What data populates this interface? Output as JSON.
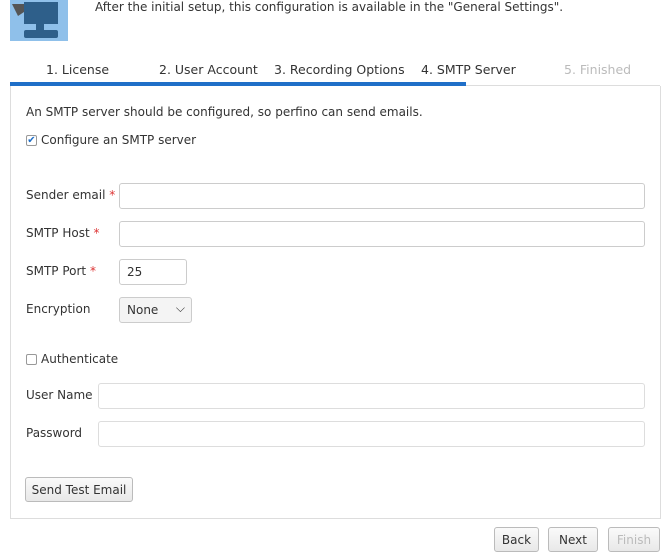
{
  "header": {
    "intro": "After the initial setup, this configuration is available in the \"General Settings\"."
  },
  "tabs": [
    {
      "label": "1. License"
    },
    {
      "label": "2. User Account"
    },
    {
      "label": "3. Recording Options"
    },
    {
      "label": "4. SMTP Server",
      "active": true
    },
    {
      "label": "5. Finished",
      "disabled": true
    }
  ],
  "progress_percent": 70,
  "form": {
    "description": "An SMTP server should be configured, so perfino can send emails.",
    "configure_smtp": {
      "label": "Configure an SMTP server",
      "checked": true
    },
    "sender_email": {
      "label": "Sender email",
      "required_mark": "*",
      "value": ""
    },
    "smtp_host": {
      "label": "SMTP Host",
      "required_mark": "*",
      "value": ""
    },
    "smtp_port": {
      "label": "SMTP Port",
      "required_mark": "*",
      "value": "25"
    },
    "encryption": {
      "label": "Encryption",
      "value": "None"
    },
    "authenticate": {
      "label": "Authenticate",
      "checked": false
    },
    "user_name": {
      "label": "User Name",
      "value": ""
    },
    "password": {
      "label": "Password",
      "value": ""
    },
    "send_test": "Send Test Email"
  },
  "footer": {
    "back": "Back",
    "next": "Next",
    "finish": "Finish"
  },
  "colors": {
    "accent": "#1f6fc8",
    "required": "#dd3333"
  }
}
